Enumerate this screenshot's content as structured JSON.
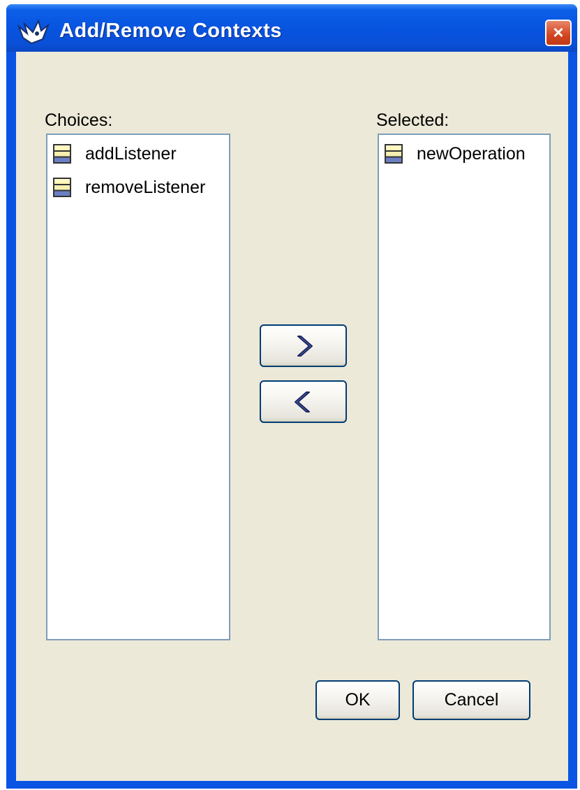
{
  "window": {
    "title": "Add/Remove Contexts",
    "close_glyph": "×"
  },
  "choices": {
    "label": "Choices:",
    "items": [
      {
        "label": "addListener",
        "icon": "operation-icon"
      },
      {
        "label": "removeListener",
        "icon": "operation-icon"
      }
    ]
  },
  "selected": {
    "label": "Selected:",
    "items": [
      {
        "label": "newOperation",
        "icon": "operation-icon"
      }
    ]
  },
  "buttons": {
    "add_glyph": "›",
    "remove_glyph": "‹",
    "ok_label": "OK",
    "cancel_label": "Cancel"
  },
  "colors": {
    "titlebar": "#0a54e3",
    "dialog_bg": "#ece9d8",
    "list_border": "#7f9db9",
    "button_border": "#003c74",
    "close_button": "#d24520"
  }
}
